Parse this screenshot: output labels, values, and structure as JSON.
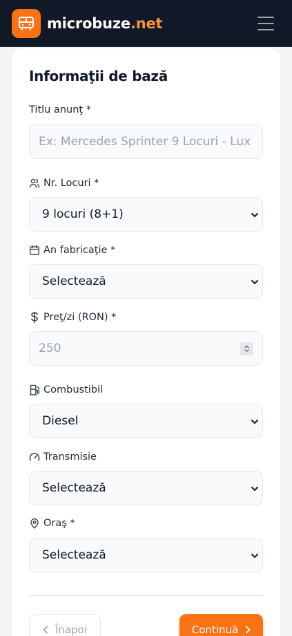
{
  "header": {
    "brand_name": "microbuze",
    "brand_tld": ".net",
    "logo_icon": "bus-icon",
    "menu_icon": "hamburger-menu-icon"
  },
  "form": {
    "section_title": "Informaţii de bază",
    "fields": {
      "title": {
        "label": "Titlu anunţ *",
        "placeholder": "Ex: Mercedes Sprinter 9 Locuri - Lux"
      },
      "seats": {
        "label": "Nr. Locuri *",
        "value": "9 locuri (8+1)",
        "icon": "users-icon"
      },
      "year": {
        "label": "An fabricaţie *",
        "value": "Selectează",
        "icon": "calendar-icon"
      },
      "price": {
        "label": "Preţ/zi (RON) *",
        "placeholder": "250",
        "icon": "dollar-icon"
      },
      "fuel": {
        "label": "Combustibil",
        "value": "Diesel",
        "icon": "fuel-pump-icon"
      },
      "transmission": {
        "label": "Transmisie",
        "value": "Selectează",
        "icon": "gauge-icon"
      },
      "city": {
        "label": "Oraş *",
        "value": "Selectează",
        "icon": "map-pin-icon"
      }
    },
    "buttons": {
      "back": "Înapoi",
      "next": "Continuă"
    }
  },
  "colors": {
    "header_bg": "#111827",
    "accent": "#f97316",
    "accent_light": "#fb923c"
  }
}
